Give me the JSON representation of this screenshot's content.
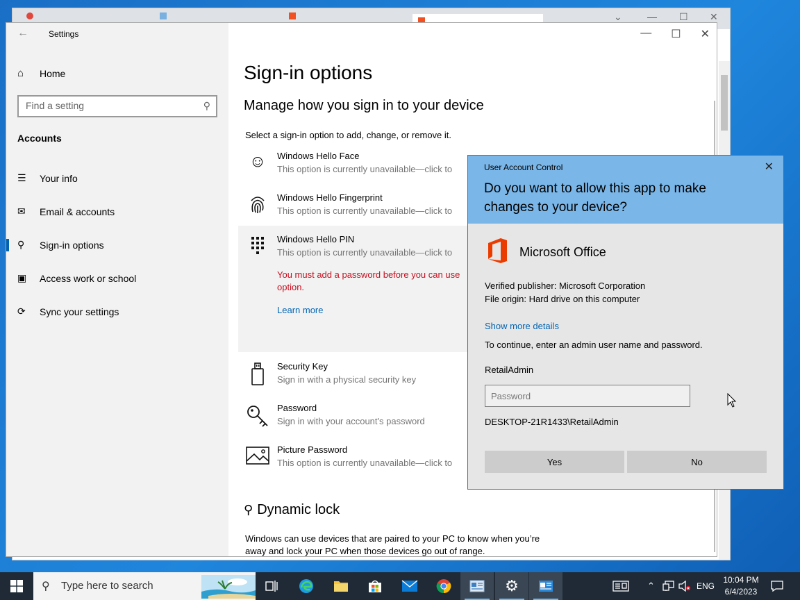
{
  "settings": {
    "app_title": "Settings",
    "home_label": "Home",
    "search_placeholder": "Find a setting",
    "section_label": "Accounts",
    "nav": [
      {
        "label": "Your info"
      },
      {
        "label": "Email & accounts"
      },
      {
        "label": "Sign-in options"
      },
      {
        "label": "Access work or school"
      },
      {
        "label": "Sync your settings"
      }
    ],
    "page_title": "Sign-in options",
    "subtitle": "Manage how you sign in to your device",
    "intro": "Select a sign-in option to add, change, or remove it.",
    "options": [
      {
        "title": "Windows Hello Face",
        "sub": "This option is currently unavailable—click to",
        "icon": "face-icon"
      },
      {
        "title": "Windows Hello Fingerprint",
        "sub": "This option is currently unavailable—click to",
        "icon": "fingerprint-icon"
      },
      {
        "title": "Windows Hello PIN",
        "sub": "This option is currently unavailable—click to",
        "icon": "pin-keypad-icon"
      },
      {
        "title": "Security Key",
        "sub": "Sign in with a physical security key",
        "icon": "usb-key-icon"
      },
      {
        "title": "Password",
        "sub": "Sign in with your account's password",
        "icon": "key-icon"
      },
      {
        "title": "Picture Password",
        "sub": "This option is currently unavailable—click to",
        "icon": "picture-icon"
      }
    ],
    "pin_error_line1": "You must add a password before you can use",
    "pin_error_line2": "option.",
    "learn_more": "Learn more",
    "dynamic_lock_title": "Dynamic lock",
    "dynamic_lock_text": "Windows can use devices that are paired to your PC to know when you’re away and lock your PC when those devices go out of range."
  },
  "uac": {
    "caption": "User Account Control",
    "question": "Do you want to allow this app to make changes to your device?",
    "app_name": "Microsoft Office",
    "publisher": "Verified publisher: Microsoft Corporation",
    "origin": "File origin: Hard drive on this computer",
    "show_more": "Show more details",
    "instruction": "To continue, enter an admin user name and password.",
    "username": "RetailAdmin",
    "password_placeholder": "Password",
    "domain_user": "DESKTOP-21R1433\\RetailAdmin",
    "yes": "Yes",
    "no": "No",
    "accent_color": "#7ab6e8",
    "office_color": "#eb3c00"
  },
  "taskbar": {
    "search_placeholder": "Type here to search",
    "language": "ENG",
    "time": "10:04 PM",
    "date": "6/4/2023",
    "apps": [
      "task-view-icon",
      "edge-icon",
      "file-explorer-icon",
      "store-icon",
      "mail-icon",
      "chrome-icon",
      "remote-app-icon",
      "settings-gear-icon",
      "uac-app-icon"
    ]
  }
}
